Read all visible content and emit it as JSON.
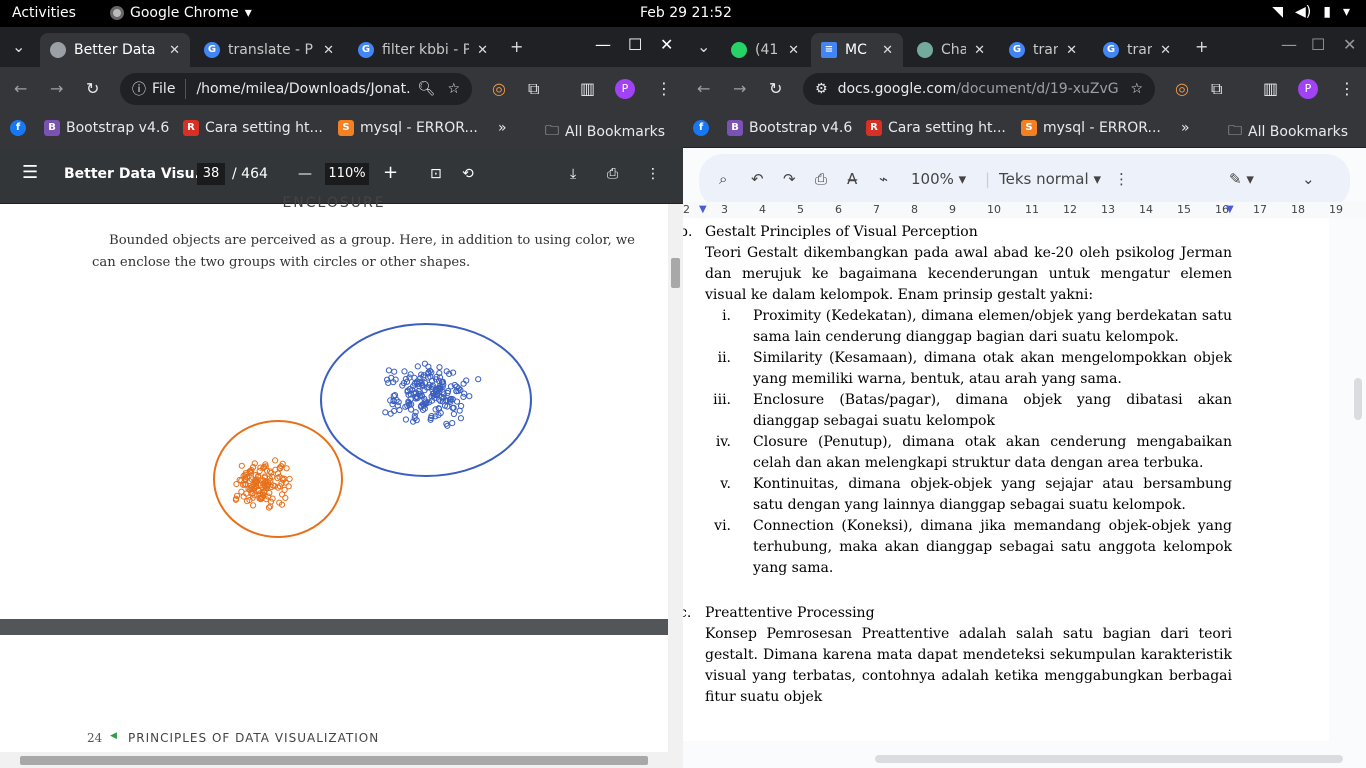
{
  "topbar": {
    "activities": "Activities",
    "app_name": "Google Chrome",
    "clock": "Feb 29  21:52"
  },
  "left": {
    "tabs": [
      {
        "title": "Better Data",
        "icon": "globe-icon"
      },
      {
        "title": "translate - P",
        "icon": "google-icon"
      },
      {
        "title": "filter kbbi - P",
        "icon": "google-icon"
      }
    ],
    "omnibox": {
      "site": "File",
      "url": "/home/milea/Downloads/Jonat..."
    },
    "profile": "P",
    "bookmarks": [
      {
        "label": "Bootstrap v4.6",
        "icon_letter": "B",
        "color": "#7952b3"
      },
      {
        "label": "Cara setting ht...",
        "icon_letter": "R",
        "color": "#d93025"
      },
      {
        "label": "mysql - ERROR...",
        "icon_letter": "S",
        "color": "#f48024"
      }
    ],
    "all_bookmarks": "All Bookmarks",
    "pdf": {
      "title": "Better Data Visu...",
      "page": "38",
      "total": "/ 464",
      "zoom": "110%",
      "heading": "ENCLOSURE",
      "paragraph": "Bounded objects are perceived as a group. Here, in addition to using color, we can enclose the two groups with circles or other shapes.",
      "footer_num": "24",
      "footer_text": "PRINCIPLES OF DATA VISUALIZATION",
      "colors": {
        "blue": "#3a5fc0",
        "orange": "#e8701a"
      }
    }
  },
  "right": {
    "tabs": [
      {
        "title": "(41",
        "icon": "whatsapp-icon",
        "color": "#25d366"
      },
      {
        "title": "MC",
        "icon": "docs-icon",
        "color": "#4285f4"
      },
      {
        "title": "Cha",
        "icon": "chatgpt-icon",
        "color": "#74aa9c"
      },
      {
        "title": "tran",
        "icon": "google-icon",
        "color": "#4285f4"
      },
      {
        "title": "tran",
        "icon": "google-icon",
        "color": "#4285f4"
      }
    ],
    "omnibox": {
      "host": "docs.google.com",
      "path": "/document/d/19-xuZvGE..."
    },
    "profile": "P",
    "bookmarks": [
      {
        "label": "Bootstrap v4.6",
        "icon_letter": "B",
        "color": "#7952b3"
      },
      {
        "label": "Cara setting ht...",
        "icon_letter": "R",
        "color": "#d93025"
      },
      {
        "label": "mysql - ERROR...",
        "icon_letter": "S",
        "color": "#f48024"
      }
    ],
    "all_bookmarks": "All Bookmarks",
    "docs": {
      "zoom": "100%",
      "style": "Teks normal",
      "ruler": [
        "2",
        "3",
        "4",
        "5",
        "6",
        "7",
        "8",
        "9",
        "10",
        "11",
        "12",
        "13",
        "14",
        "15",
        "16",
        "17",
        "18",
        "19"
      ],
      "section_b_marker": "b.",
      "section_b_title": "Gestalt Principles of Visual Perception",
      "section_b_intro": "Teori Gestalt dikembangkan pada awal abad ke-20 oleh psikolog Jerman dan merujuk ke bagaimana kecenderungan untuk mengatur elemen visual ke dalam kelompok. Enam prinsip gestalt yakni:",
      "items": [
        {
          "num": "i.",
          "text": "Proximity (Kedekatan), dimana elemen/objek yang berdekatan satu sama lain cenderung dianggap bagian dari suatu kelompok."
        },
        {
          "num": "ii.",
          "text": "Similarity (Kesamaan), dimana otak akan mengelompokkan objek yang memiliki warna, bentuk, atau arah yang sama."
        },
        {
          "num": "iii.",
          "text": "Enclosure (Batas/pagar), dimana objek yang dibatasi akan dianggap sebagai suatu kelompok"
        },
        {
          "num": "iv.",
          "text": "Closure (Penutup), dimana otak akan cenderung mengabaikan celah dan akan melengkapi struktur data dengan area terbuka."
        },
        {
          "num": "v.",
          "text": "Kontinuitas, dimana objek-objek yang sejajar atau bersambung satu dengan yang lainnya dianggap sebagai suatu kelompok."
        },
        {
          "num": "vi.",
          "text": "Connection (Koneksi), dimana jika memandang objek-objek yang terhubung, maka akan dianggap sebagai satu anggota kelompok yang sama."
        }
      ],
      "section_c_marker": "c.",
      "section_c_title": "Preattentive Processing",
      "section_c_text": "Konsep Pemrosesan Preattentive adalah salah satu bagian dari teori gestalt. Dimana karena mata dapat mendeteksi sekumpulan karakteristik visual yang terbatas, contohnya adalah ketika menggabungkan berbagai fitur suatu objek"
    }
  }
}
